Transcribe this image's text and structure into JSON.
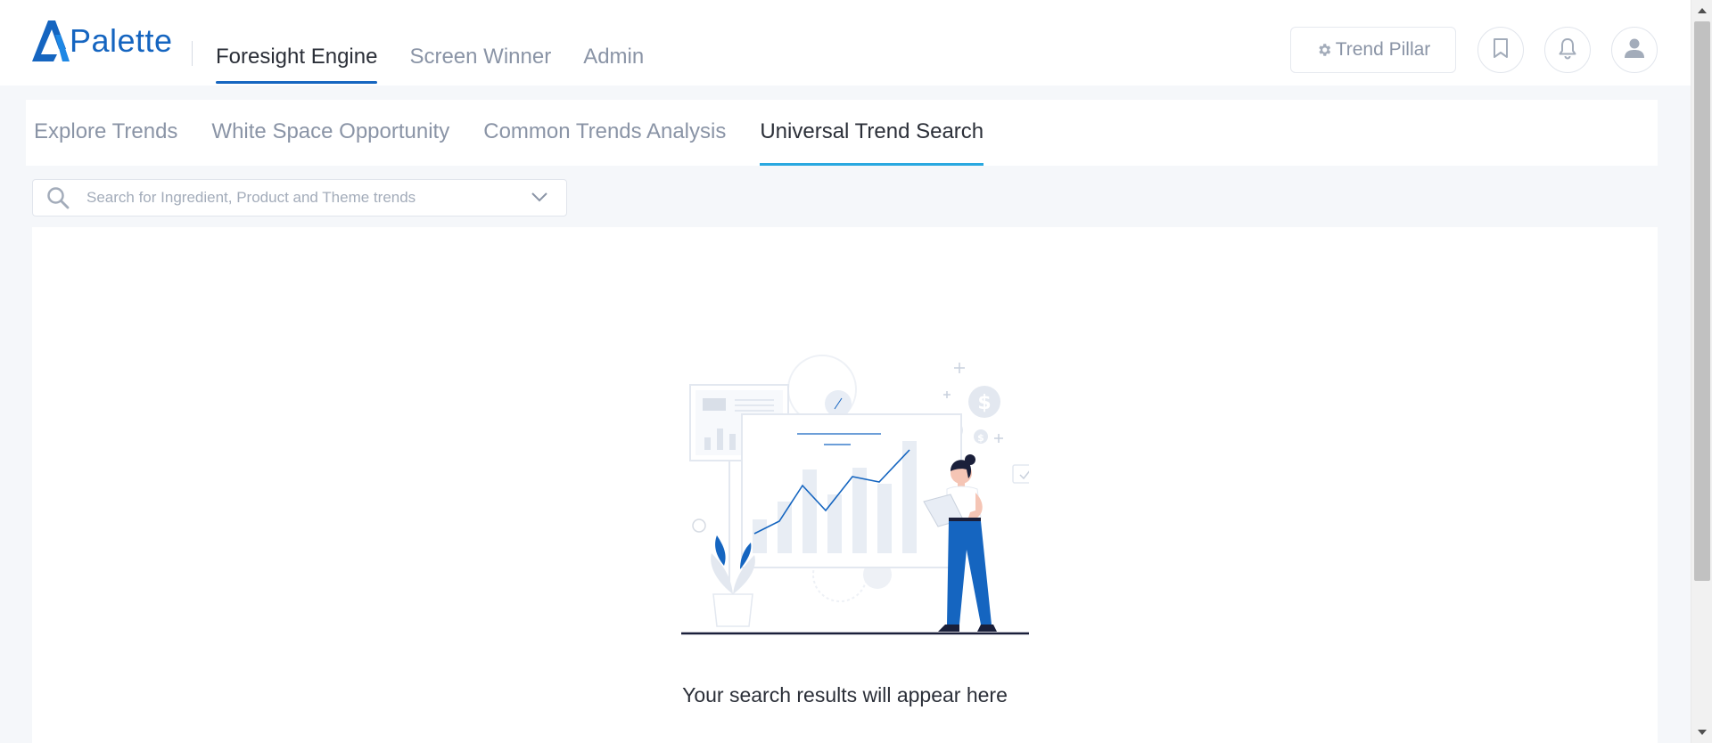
{
  "app": {
    "logo_text": "Palette",
    "brand_color": "#1565c0"
  },
  "main_nav": {
    "items": [
      {
        "label": "Foresight Engine",
        "active": true
      },
      {
        "label": "Screen Winner",
        "active": false
      },
      {
        "label": "Admin",
        "active": false
      }
    ]
  },
  "header_actions": {
    "trend_pillar_label": "Trend Pillar",
    "icons": [
      "gear-icon",
      "bookmark-icon",
      "bell-icon",
      "user-icon"
    ]
  },
  "sub_tabs": {
    "items": [
      {
        "label": "Explore Trends",
        "active": false
      },
      {
        "label": "White Space Opportunity",
        "active": false
      },
      {
        "label": "Common Trends Analysis",
        "active": false
      },
      {
        "label": "Universal Trend Search",
        "active": true
      }
    ],
    "active_underline_color": "#29a8e0"
  },
  "search": {
    "placeholder": "Search for Ingredient, Product and Theme trends",
    "value": ""
  },
  "results": {
    "empty_message": "Your search results will appear here"
  }
}
